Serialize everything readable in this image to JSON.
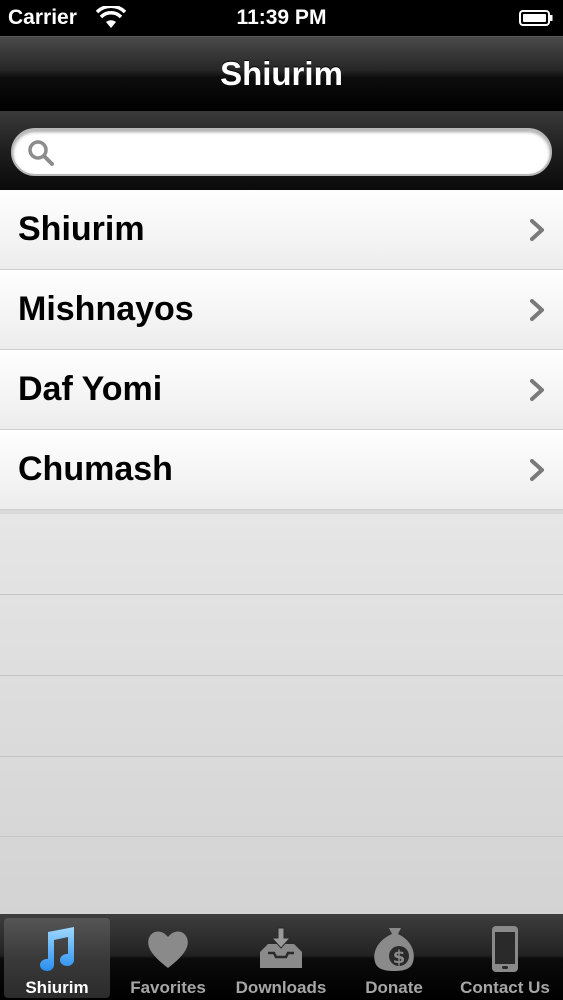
{
  "status_bar": {
    "carrier": "Carrier",
    "time": "11:39 PM"
  },
  "nav": {
    "title": "Shiurim"
  },
  "search": {
    "value": "",
    "placeholder": ""
  },
  "list": {
    "items": [
      {
        "label": "Shiurim"
      },
      {
        "label": "Mishnayos"
      },
      {
        "label": "Daf Yomi"
      },
      {
        "label": "Chumash"
      }
    ]
  },
  "tab_bar": {
    "selected": "Shiurim",
    "tabs": [
      {
        "label": "Shiurim",
        "icon": "music-note-icon"
      },
      {
        "label": "Favorites",
        "icon": "heart-icon"
      },
      {
        "label": "Downloads",
        "icon": "download-tray-icon"
      },
      {
        "label": "Donate",
        "icon": "money-bag-icon"
      },
      {
        "label": "Contact Us",
        "icon": "phone-icon"
      }
    ]
  },
  "colors": {
    "selected_tab_icon": "#3fa9f5",
    "inactive_tab_icon": "#8a8a8a"
  }
}
